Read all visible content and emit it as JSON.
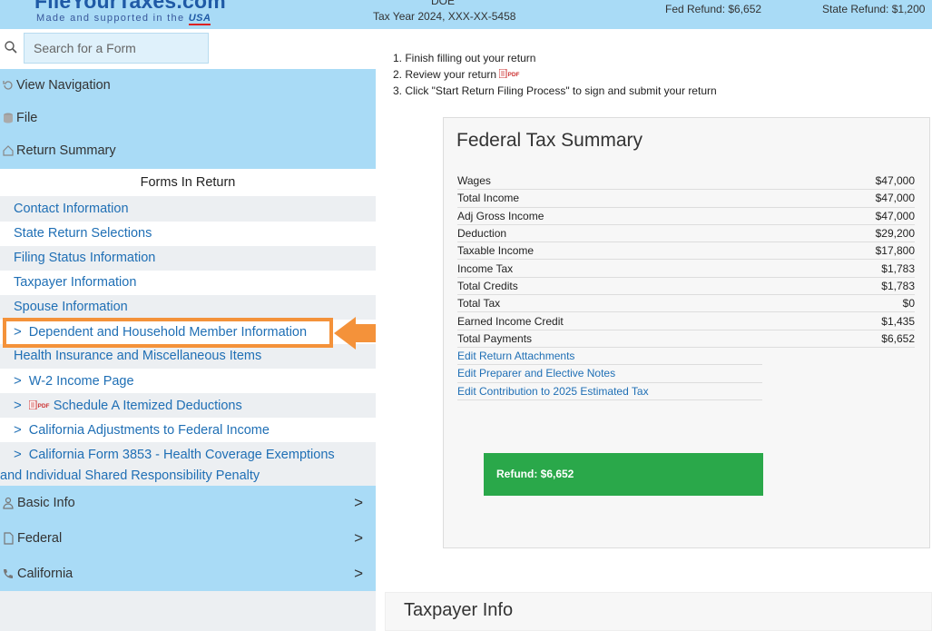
{
  "header": {
    "logo_text": "FileYourTaxes.com",
    "tagline": "Made and supported in the",
    "tagline_usa": "USA",
    "name": "DOE",
    "tax_year": "Tax Year 2024, XXX-XX-5458",
    "fed_refund": "Fed Refund: $6,652",
    "state_refund": "State Refund: $1,200"
  },
  "sidebar": {
    "search_placeholder": "Search for a Form",
    "nav": [
      {
        "label": "View Navigation",
        "icon": "refresh-icon"
      },
      {
        "label": "File",
        "icon": "database-icon"
      },
      {
        "label": "Return Summary",
        "icon": "home-icon"
      }
    ],
    "forms_header": "Forms In Return",
    "forms": [
      {
        "label": "Contact Information",
        "chevron": false
      },
      {
        "label": "State Return Selections",
        "chevron": false
      },
      {
        "label": "Filing Status Information",
        "chevron": false
      },
      {
        "label": "Taxpayer Information",
        "chevron": false
      },
      {
        "label": "Spouse Information",
        "chevron": false
      },
      {
        "label": "Dependent and Household Member Information",
        "chevron": true
      },
      {
        "label": "Health Insurance and Miscellaneous Items",
        "chevron": false
      },
      {
        "label": "W-2 Income Page",
        "chevron": true
      },
      {
        "label": "Schedule A Itemized Deductions",
        "chevron": true,
        "pdf": true
      },
      {
        "label": "California Adjustments to Federal Income",
        "chevron": true
      },
      {
        "label": "California Form 3853 - Health Coverage Exemptions",
        "label2": "and Individual Shared Responsibility Penalty",
        "chevron": true
      }
    ],
    "categories": [
      {
        "label": "Basic Info",
        "icon": "user-icon"
      },
      {
        "label": "Federal",
        "icon": "document-icon"
      },
      {
        "label": "California",
        "icon": "phone-icon"
      }
    ],
    "category_chevron": ">"
  },
  "main": {
    "instructions": [
      "1. Finish filling out your return",
      "2. Review your return",
      "3. Click \"Start Return Filing Process\" to sign and submit your return"
    ],
    "pdf_label": "PDF",
    "summary": {
      "title": "Federal Tax Summary",
      "rows": [
        {
          "label": "Wages",
          "value": "$47,000"
        },
        {
          "label": "Total Income",
          "value": "$47,000"
        },
        {
          "label": "Adj Gross Income",
          "value": "$47,000"
        },
        {
          "label": "Deduction",
          "value": "$29,200"
        },
        {
          "label": "Taxable Income",
          "value": "$17,800"
        },
        {
          "label": "Income Tax",
          "value": "$1,783"
        },
        {
          "label": "Total Credits",
          "value": "$1,783"
        },
        {
          "label": "Total Tax",
          "value": "$0"
        },
        {
          "label": "Earned Income Credit",
          "value": "$1,435"
        },
        {
          "label": "Total Payments",
          "value": "$6,652"
        }
      ],
      "links": [
        "Edit Return Attachments",
        "Edit Preparer and Elective Notes",
        "Edit Contribution to 2025 Estimated Tax"
      ],
      "refund_button": "Refund: $6,652"
    },
    "taxpayer_title": "Taxpayer Info"
  },
  "colors": {
    "header_bg": "#a9dbf6",
    "link": "#1f6fb5",
    "highlight": "#f4923a",
    "refund_green": "#2aa84a"
  }
}
